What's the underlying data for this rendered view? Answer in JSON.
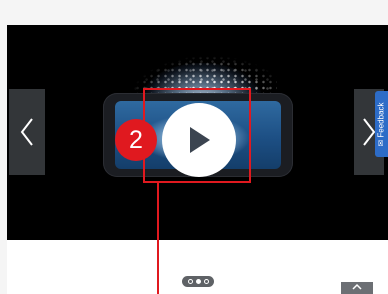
{
  "badge": {
    "number": "2"
  },
  "feedback": {
    "label": "Feedback",
    "icon": "chat-icon"
  },
  "carousel": {
    "slides": 3,
    "active": 2
  },
  "colors": {
    "highlight": "#e0191f",
    "feedback": "#2d6cc7"
  }
}
